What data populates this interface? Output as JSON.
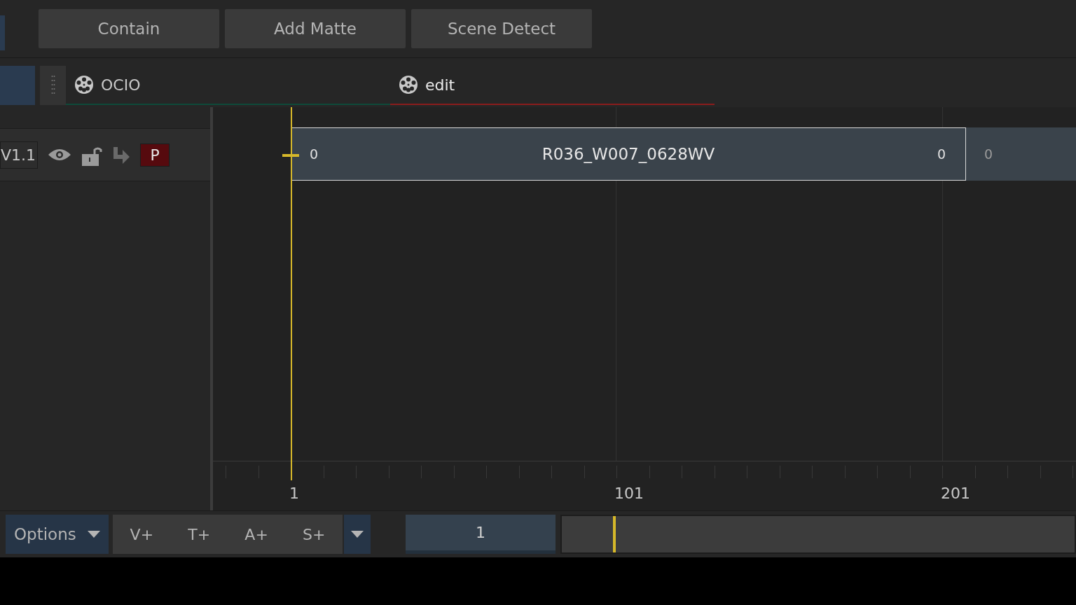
{
  "toolbar": {
    "buttons": [
      "Contain",
      "Add Matte",
      "Scene Detect"
    ]
  },
  "tabs": [
    {
      "label": "OCIO",
      "selected": false,
      "color": "#0e4a3a"
    },
    {
      "label": "edit",
      "selected": true,
      "color": "#8a1c1c"
    }
  ],
  "track": {
    "name": "V1.1",
    "visible": true,
    "locked": false,
    "patch": "P"
  },
  "clips": [
    {
      "name": "R036_W007_0628WV",
      "in": "0",
      "out": "0",
      "selected": true
    },
    {
      "in": "0",
      "selected": false
    }
  ],
  "ruler": {
    "labels": [
      "1",
      "101",
      "201"
    ]
  },
  "bottom": {
    "options": "Options",
    "add_buttons": [
      "V+",
      "T+",
      "A+",
      "S+"
    ],
    "frame": "1",
    "scrubber": {
      "level": 0.1
    }
  }
}
